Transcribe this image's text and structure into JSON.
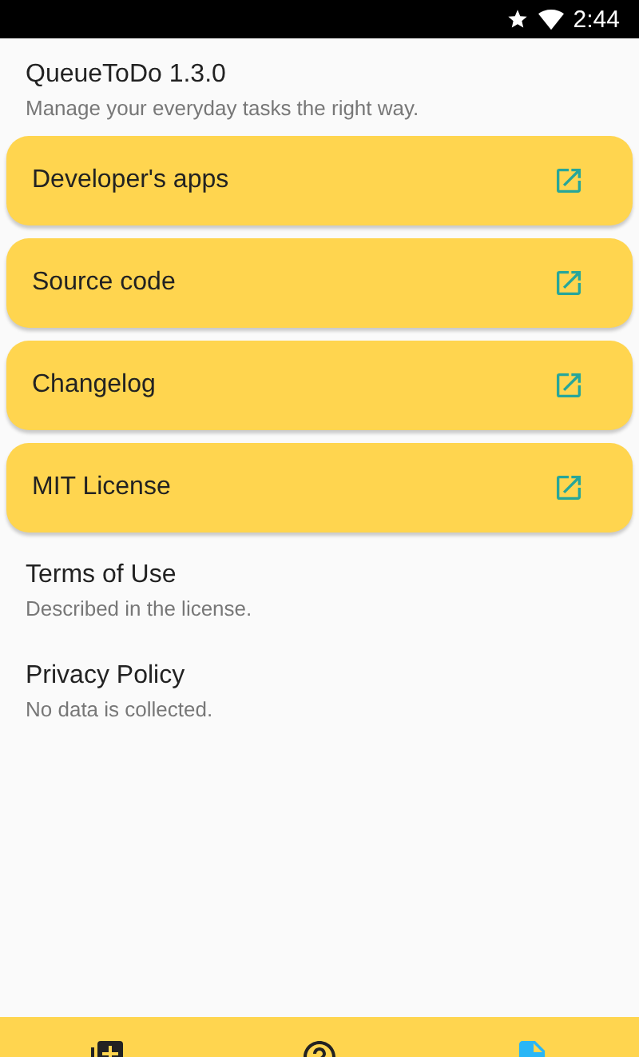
{
  "status_bar": {
    "time": "2:44"
  },
  "header": {
    "title": "QueueToDo 1.3.0",
    "subtitle": "Manage your everyday tasks the right way."
  },
  "links": [
    {
      "label": "Developer's apps"
    },
    {
      "label": "Source code"
    },
    {
      "label": "Changelog"
    },
    {
      "label": "MIT License"
    }
  ],
  "info": [
    {
      "title": "Terms of Use",
      "subtitle": "Described in the license."
    },
    {
      "title": "Privacy Policy",
      "subtitle": "No data is collected."
    }
  ],
  "bottom_nav": [
    {
      "kind": "add",
      "selected": false
    },
    {
      "kind": "help",
      "selected": false
    },
    {
      "kind": "document",
      "selected": true
    }
  ]
}
